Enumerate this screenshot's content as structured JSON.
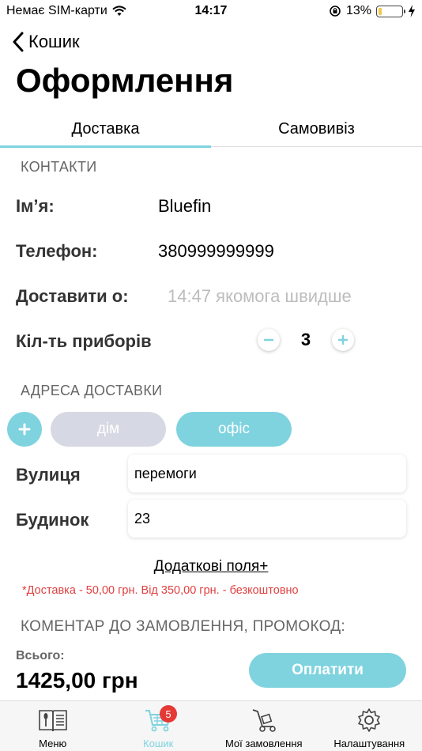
{
  "status": {
    "carrier": "Немає SIM-карти",
    "time": "14:17",
    "battery": "13%",
    "battery_level": 0.13
  },
  "nav": {
    "back_label": "Кошик",
    "title": "Оформлення"
  },
  "tabs": [
    {
      "label": "Доставка",
      "active": true
    },
    {
      "label": "Самовивіз",
      "active": false
    }
  ],
  "contacts": {
    "header": "КОНТАКТИ",
    "name_label": "Ім’я:",
    "name_value": "Bluefin",
    "phone_label": "Телефон:",
    "phone_value": "380999999999",
    "deliver_label": "Доставити о:",
    "deliver_placeholder": "14:47 якомога швидше",
    "cutlery_label": "Кіл-ть приборів",
    "cutlery_count": "3"
  },
  "address": {
    "header": "АДРЕСА ДОСТАВКИ",
    "chips": [
      "дім",
      "офіс"
    ],
    "street_label": "Вулиця",
    "street_value": "перемоги",
    "house_label": "Будинок",
    "house_value": "23",
    "extra_link": "Додаткові поля+",
    "delivery_note": "*Доставка - 50,00 грн. Від 350,00 грн. - безкоштовно"
  },
  "comment": {
    "header": "КОМЕНТАР ДО ЗАМОВЛЕННЯ, ПРОМОКОД:"
  },
  "summary": {
    "total_label": "Всього:",
    "total_value": "1425,00 грн",
    "pay_label": "Оплатити"
  },
  "tabbar": {
    "items": [
      {
        "label": "Меню",
        "icon": "menu-book-icon"
      },
      {
        "label": "Кошик",
        "icon": "cart-icon",
        "active": true
      },
      {
        "label": "Мої замовлення",
        "icon": "delivery-cart-icon"
      },
      {
        "label": "Налаштування",
        "icon": "gear-icon"
      }
    ],
    "cart_badge": "5"
  },
  "colors": {
    "accent": "#7fd3df",
    "chip_inactive": "#d6d9e3",
    "note": "#e04040",
    "badge": "#e53935"
  }
}
